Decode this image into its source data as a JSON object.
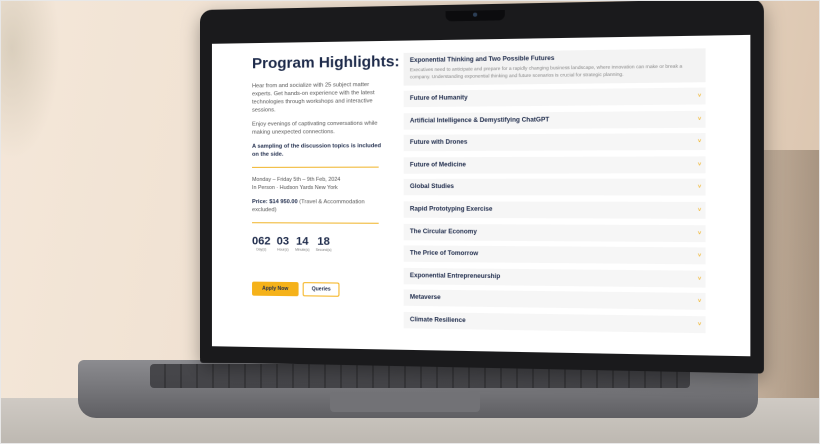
{
  "page": {
    "title": "Program Highlights:",
    "intro_1": "Hear from and socialize with 25 subject matter experts. Get hands-on experience with the latest technologies through workshops and interactive sessions.",
    "intro_2": "Enjoy evenings of captivating conversations while making unexpected connections.",
    "intro_3": "A sampling of the discussion topics is included on the side.",
    "dates": "Monday – Friday 5th – 9th Feb, 2024",
    "location": "In Person · Hudson Yards New York",
    "price_label": "Price: $14 950.00",
    "price_note": "(Travel & Accommodation excluded)",
    "countdown": [
      {
        "value": "062",
        "label": "Day(s)"
      },
      {
        "value": "03",
        "label": "Hour(s)"
      },
      {
        "value": "14",
        "label": "Minute(s)"
      },
      {
        "value": "18",
        "label": "Second(s)"
      }
    ],
    "apply_label": "Apply Now",
    "queries_label": "Queries"
  },
  "topics": {
    "open": {
      "title": "Exponential Thinking and Two Possible Futures",
      "description": "Executives need to anticipate and prepare for a rapidly changing business landscape, where innovation can make or break a company. Understanding exponential thinking and future scenarios is crucial for strategic planning."
    },
    "items": [
      "Future of Humanity",
      "Artificial Intelligence & Demystifying ChatGPT",
      "Future with Drones",
      "Future of Medicine",
      "Global Studies",
      "Rapid Prototyping Exercise",
      "The Circular Economy",
      "The Price of Tomorrow",
      "Exponential Entrepreneurship",
      "Metaverse",
      "Climate Resilience"
    ]
  },
  "colors": {
    "accent": "#f5b21a",
    "heading": "#1d2a4a"
  }
}
